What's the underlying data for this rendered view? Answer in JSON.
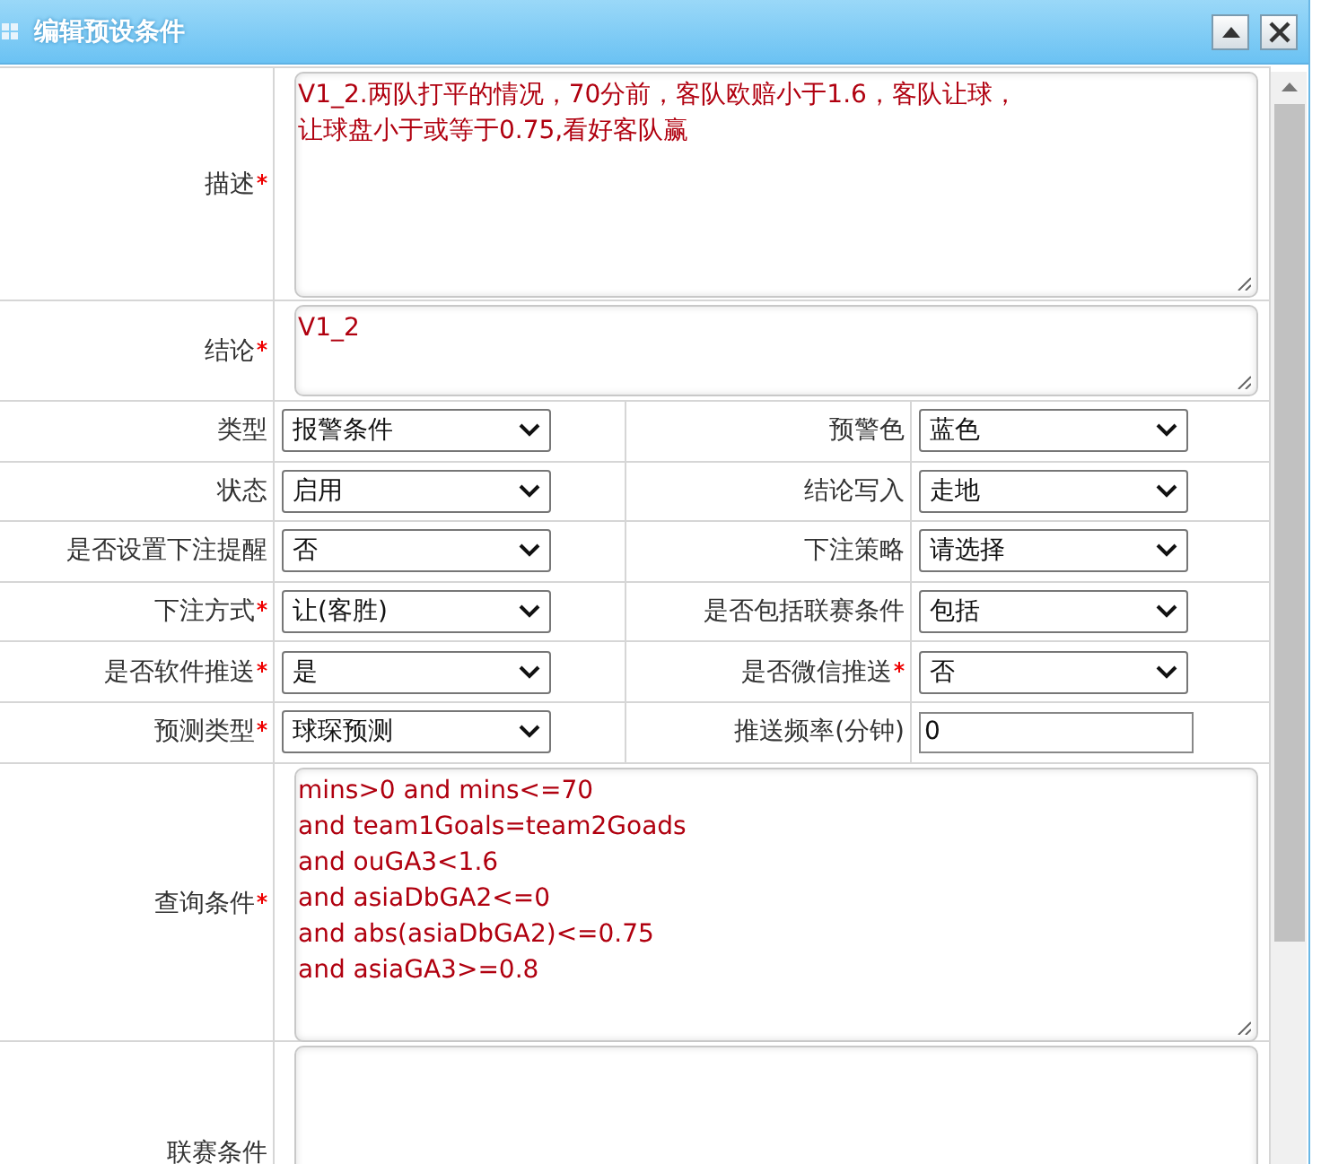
{
  "window": {
    "title": "编辑预设条件"
  },
  "form": {
    "rows": [
      {
        "kind": "textarea",
        "label": "描述",
        "required": true,
        "lines": [
          "V1_2.两队打平的情况，70分前，客队欧赔小于1.6，客队让球，",
          "让球盘小于或等于0.75,看好客队赢"
        ]
      },
      {
        "kind": "textarea",
        "label": "结论",
        "required": true,
        "lines": [
          "V1_2"
        ]
      },
      {
        "kind": "pair",
        "fields": [
          {
            "kind": "select",
            "label": "类型",
            "required": false,
            "value": "报警条件"
          },
          {
            "kind": "select",
            "label": "预警色",
            "required": false,
            "value": "蓝色"
          }
        ]
      },
      {
        "kind": "pair",
        "fields": [
          {
            "kind": "select",
            "label": "状态",
            "required": false,
            "value": "启用"
          },
          {
            "kind": "select",
            "label": "结论写入",
            "required": false,
            "value": "走地"
          }
        ]
      },
      {
        "kind": "pair",
        "fields": [
          {
            "kind": "select",
            "label": "是否设置下注提醒",
            "required": false,
            "value": "否"
          },
          {
            "kind": "select",
            "label": "下注策略",
            "required": false,
            "value": "请选择"
          }
        ]
      },
      {
        "kind": "pair",
        "fields": [
          {
            "kind": "select",
            "label": "下注方式",
            "required": true,
            "value": "让(客胜)"
          },
          {
            "kind": "select",
            "label": "是否包括联赛条件",
            "required": false,
            "value": "包括"
          }
        ]
      },
      {
        "kind": "pair",
        "fields": [
          {
            "kind": "select",
            "label": "是否软件推送",
            "required": true,
            "value": "是"
          },
          {
            "kind": "select",
            "label": "是否微信推送",
            "required": true,
            "value": "否"
          }
        ]
      },
      {
        "kind": "pair",
        "fields": [
          {
            "kind": "select",
            "label": "预测类型",
            "required": true,
            "value": "球琛预测"
          },
          {
            "kind": "input",
            "label": "推送频率(分钟)",
            "required": false,
            "value": "0"
          }
        ]
      },
      {
        "kind": "textarea",
        "label": "查询条件",
        "required": true,
        "lines": [
          "mins>0 and mins<=70",
          "and team1Goals=team2Goads",
          "and ouGA3<1.6",
          "and asiaDbGA2<=0",
          "and abs(asiaDbGA2)<=0.75",
          "and asiaGA3>=0.8"
        ]
      },
      {
        "kind": "textarea",
        "label": "联赛条件",
        "required": false
      }
    ]
  }
}
